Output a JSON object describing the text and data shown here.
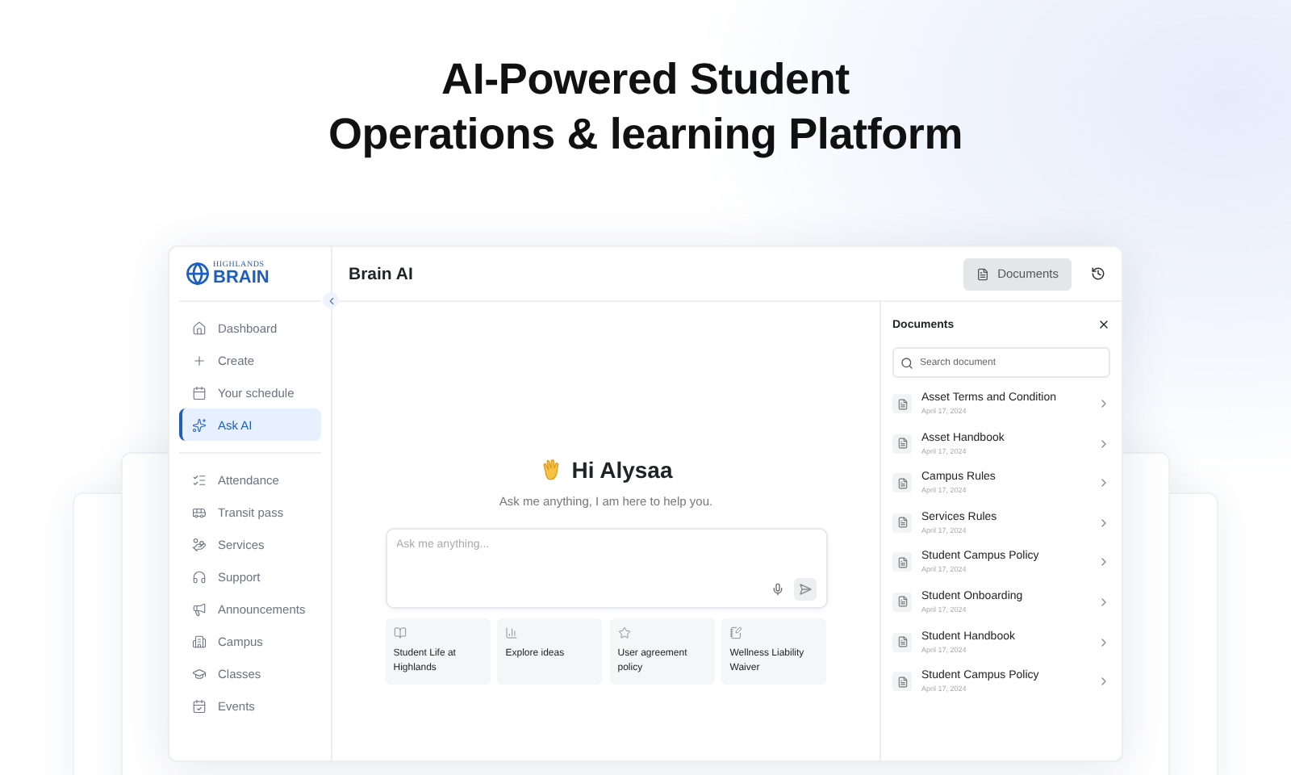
{
  "headline": [
    "AI-Powered Student",
    "Operations & learning Platform"
  ],
  "sidebar": {
    "logo": {
      "small": "HIGHLANDS",
      "big": "BRAIN"
    },
    "primary_items": [
      {
        "label": "Dashboard",
        "selected": false
      },
      {
        "label": "Create",
        "selected": false
      },
      {
        "label": "Your schedule",
        "selected": false
      },
      {
        "label": "Ask AI",
        "selected": true
      }
    ],
    "secondary_items": [
      {
        "label": "Attendance",
        "selected": false
      },
      {
        "label": "Transit pass",
        "selected": false
      },
      {
        "label": "Services",
        "selected": false
      },
      {
        "label": "Support",
        "selected": false
      },
      {
        "label": "Announcements",
        "selected": false
      },
      {
        "label": "Campus",
        "selected": false
      },
      {
        "label": "Classes",
        "selected": false
      },
      {
        "label": "Events",
        "selected": false
      }
    ]
  },
  "header": {
    "title": "Brain AI",
    "documents_button": {
      "label": "Documents",
      "active": true
    }
  },
  "chat": {
    "greeting": "Hi Alysaa",
    "subtitle": "Ask me anything, I am here to help you.",
    "input": {
      "placeholder": "Ask me anything..."
    },
    "suggestions": [
      {
        "label": "Student Life at Highlands"
      },
      {
        "label": "Explore ideas"
      },
      {
        "label": "User agreement policy"
      },
      {
        "label": "Wellness Liability Waiver"
      }
    ]
  },
  "documents_panel": {
    "title": "Documents",
    "search": {
      "placeholder": "Search document"
    },
    "items": [
      {
        "title": "Asset Terms and Condition",
        "date": "April 17, 2024"
      },
      {
        "title": "Asset Handbook",
        "date": "April 17, 2024"
      },
      {
        "title": "Campus Rules",
        "date": "April 17, 2024"
      },
      {
        "title": "Services Rules",
        "date": "April 17, 2024"
      },
      {
        "title": "Student Campus Policy",
        "date": "April 17, 2024"
      },
      {
        "title": "Student Onboarding",
        "date": "April 17, 2024"
      },
      {
        "title": "Student Handbook",
        "date": "April 17, 2024"
      },
      {
        "title": "Student Campus Policy",
        "date": "April 17, 2024"
      }
    ]
  }
}
